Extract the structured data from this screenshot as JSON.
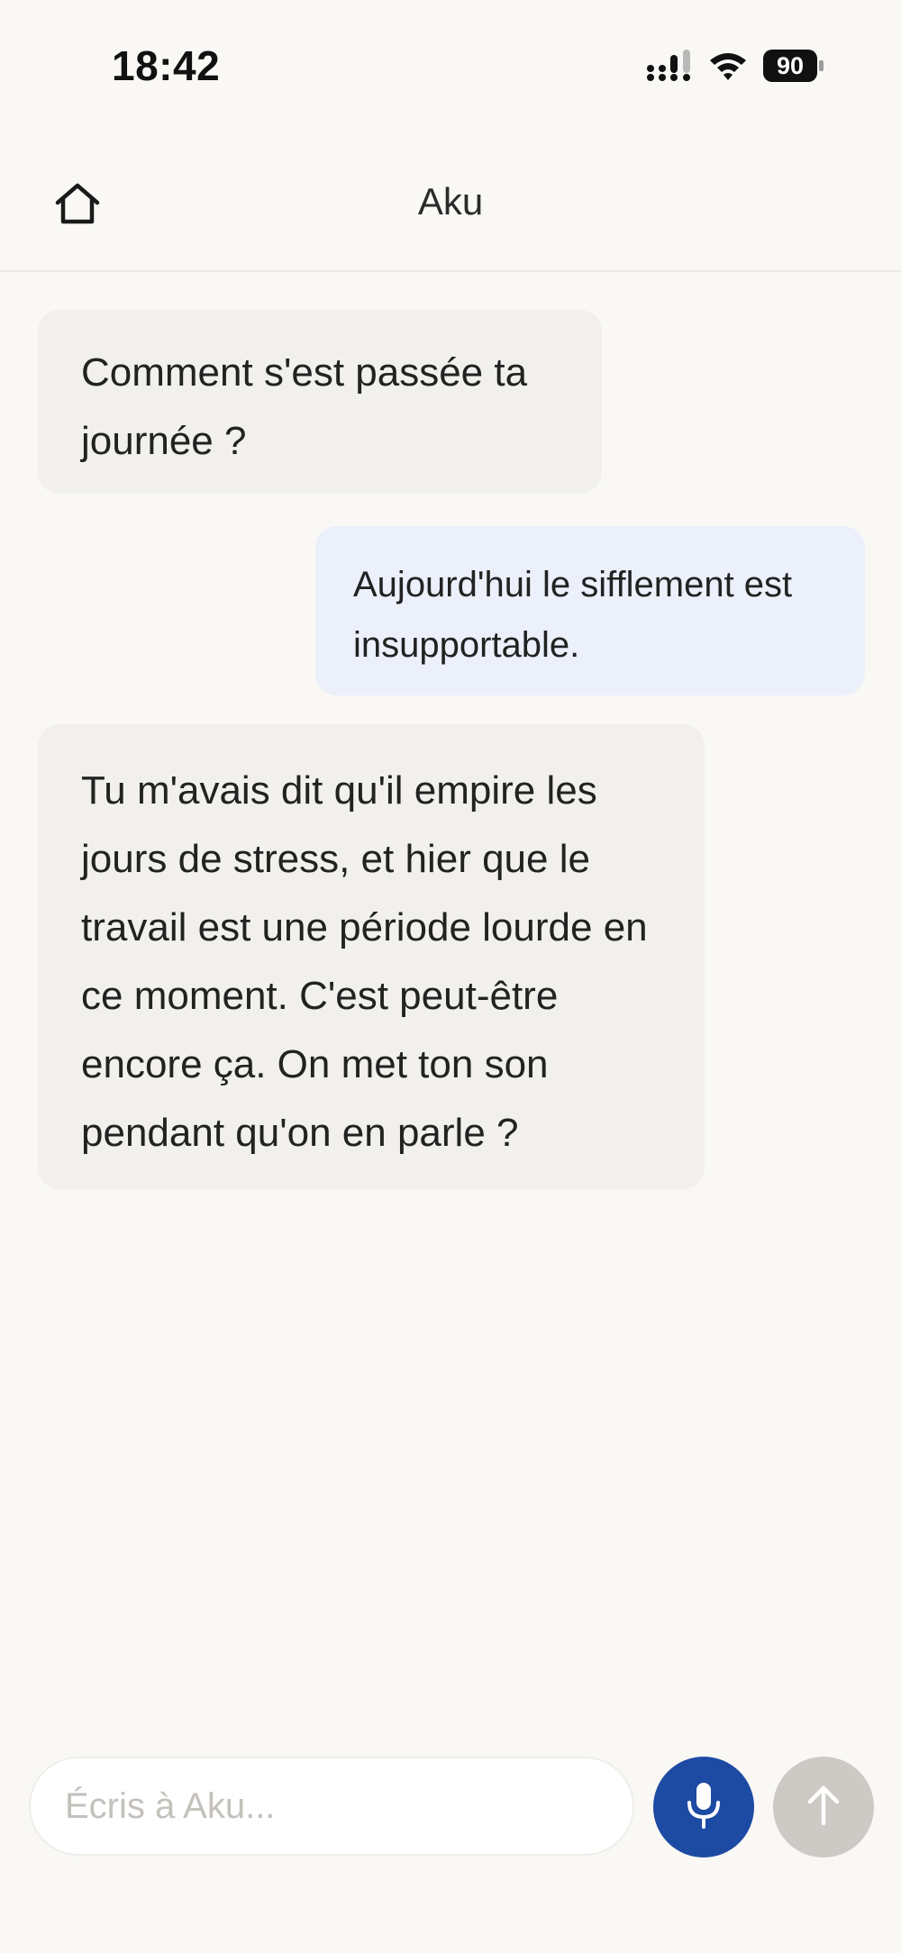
{
  "status_bar": {
    "time": "18:42",
    "battery_level": "90",
    "icons": [
      "signal-icon",
      "wifi-icon",
      "battery-icon"
    ]
  },
  "header": {
    "title": "Aku",
    "home_icon": "home-icon"
  },
  "messages": [
    {
      "sender": "bot",
      "text": "Comment s'est passée ta journée ?"
    },
    {
      "sender": "user",
      "text": "Aujourd'hui le sifflement est insupportable."
    },
    {
      "sender": "bot",
      "text": "Tu m'avais dit qu'il empire les jours de stress, et hier que le travail est une période lourde en ce moment. C'est peut-être encore ça. On met ton son pendant qu'on en parle ?"
    }
  ],
  "composer": {
    "placeholder": "Écris à Aku...",
    "value": "",
    "mic_icon": "microphone-icon",
    "send_icon": "arrow-up-icon"
  },
  "colors": {
    "background": "#f9f8f5",
    "bot_bubble": "#f2f0ec",
    "user_bubble": "#ebf0fa",
    "accent": "#1d4aa3",
    "send_disabled": "#cdc9c4"
  }
}
